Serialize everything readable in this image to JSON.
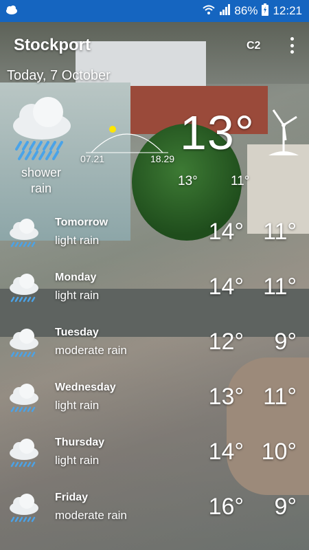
{
  "status_bar": {
    "battery": "86%",
    "time": "12:21",
    "icons": [
      "weather-icon",
      "wifi-icon",
      "signal-icon",
      "battery-icon"
    ]
  },
  "header": {
    "city": "Stockport",
    "badge": "C2",
    "date": "Today, 7 October"
  },
  "current": {
    "icon": "shower-rain-icon",
    "condition_line1": "shower",
    "condition_line2": "rain",
    "sunrise": "07.21",
    "sunset": "18.29",
    "temp": "13°",
    "high": "13°",
    "low": "11°"
  },
  "forecast": [
    {
      "day": "Tomorrow",
      "condition": "light rain",
      "high": "14°",
      "low": "11°",
      "icon": "rain-cloud-icon"
    },
    {
      "day": "Monday",
      "condition": "light rain",
      "high": "14°",
      "low": "11°",
      "icon": "rain-cloud-icon"
    },
    {
      "day": "Tuesday",
      "condition": "moderate rain",
      "high": "12°",
      "low": "9°",
      "icon": "rain-cloud-icon"
    },
    {
      "day": "Wednesday",
      "condition": "light rain",
      "high": "13°",
      "low": "11°",
      "icon": "rain-cloud-icon"
    },
    {
      "day": "Thursday",
      "condition": "light rain",
      "high": "14°",
      "low": "10°",
      "icon": "rain-cloud-icon"
    },
    {
      "day": "Friday",
      "condition": "moderate rain",
      "high": "16°",
      "low": "9°",
      "icon": "rain-cloud-icon"
    }
  ],
  "colors": {
    "status_bar": "#1565c0",
    "rain": "#4aa3e8"
  }
}
